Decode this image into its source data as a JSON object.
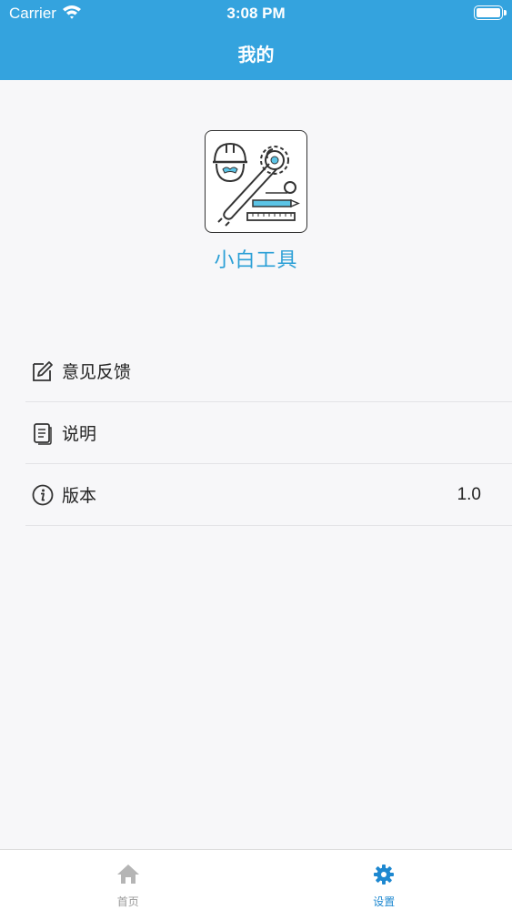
{
  "status_bar": {
    "carrier": "Carrier",
    "time": "3:08 PM"
  },
  "header": {
    "title": "我的"
  },
  "app": {
    "name": "小白工具",
    "logo_icon": "tools-logo-icon"
  },
  "menu": {
    "items": [
      {
        "label": "意见反馈",
        "icon": "edit-icon"
      },
      {
        "label": "说明",
        "icon": "document-icon"
      },
      {
        "label": "版本",
        "icon": "info-icon",
        "value": "1.0"
      }
    ]
  },
  "tabbar": {
    "tabs": [
      {
        "label": "首页",
        "icon": "home-icon",
        "active": false
      },
      {
        "label": "设置",
        "icon": "gear-icon",
        "active": true
      }
    ]
  },
  "colors": {
    "primary": "#34a3de",
    "tab_active": "#1e88d0",
    "tab_inactive": "#999999"
  }
}
